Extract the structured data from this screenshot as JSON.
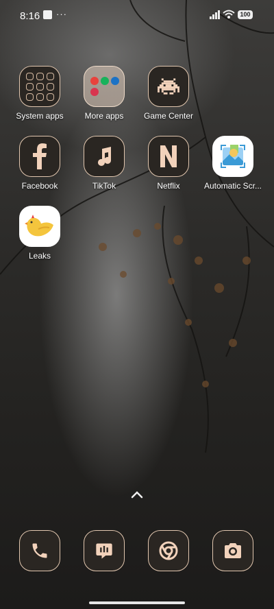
{
  "status_bar": {
    "time": "8:16",
    "more": "···",
    "battery": "100"
  },
  "apps": [
    {
      "label": "System apps",
      "icon": "system-apps-folder-icon"
    },
    {
      "label": "More apps",
      "icon": "more-apps-folder-icon"
    },
    {
      "label": "Game Center",
      "icon": "game-center-icon"
    },
    {
      "label": "Facebook",
      "icon": "facebook-icon"
    },
    {
      "label": "TikTok",
      "icon": "tiktok-icon"
    },
    {
      "label": "Netflix",
      "icon": "netflix-icon"
    },
    {
      "label": "Automatic Scr...",
      "icon": "automatic-screenshot-icon"
    },
    {
      "label": "Leaks",
      "icon": "leaks-bird-icon"
    }
  ],
  "dock": [
    {
      "icon": "phone-icon"
    },
    {
      "icon": "messages-icon"
    },
    {
      "icon": "chrome-icon"
    },
    {
      "icon": "camera-icon"
    }
  ],
  "colors": {
    "icon_bg": "#2a2622",
    "icon_glyph": "#f2d2bb",
    "icon_border": "#e3c8b0"
  }
}
